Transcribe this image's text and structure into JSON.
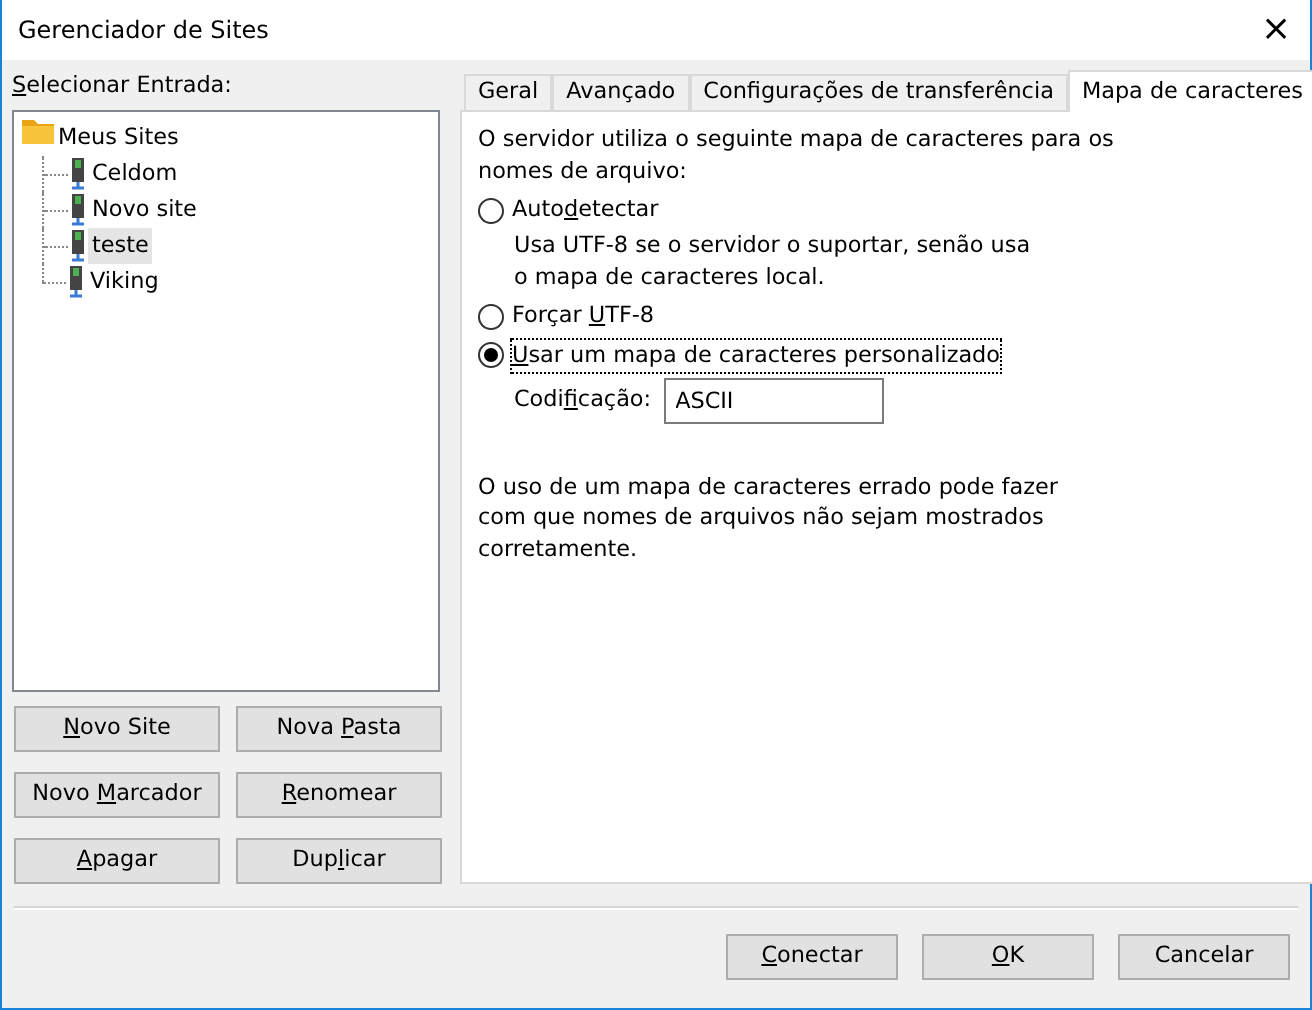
{
  "window": {
    "title": "Gerenciador de Sites",
    "close": "×"
  },
  "tree_label": {
    "key": "S",
    "post": "elecionar Entrada:"
  },
  "tree": {
    "label": "Meus Sites",
    "selected": false,
    "children": [
      {
        "label": "Celdom",
        "selected": false
      },
      {
        "label": "Novo site",
        "selected": false
      },
      {
        "label": "teste",
        "selected": true
      },
      {
        "label": "Viking",
        "selected": false
      }
    ]
  },
  "site_buttons": [
    {
      "key": "N",
      "post": "ovo Site"
    },
    {
      "pre": "Nova ",
      "key": "P",
      "post": "asta"
    },
    {
      "pre": "Novo ",
      "key": "M",
      "post": "arcador"
    },
    {
      "key": "R",
      "post": "enomear"
    },
    {
      "key": "A",
      "post": "pagar"
    },
    {
      "pre": "Dup",
      "key": "l",
      "post": "icar"
    }
  ],
  "tabs": [
    {
      "label": "Geral",
      "selected": false
    },
    {
      "label": "Avançado",
      "selected": false
    },
    {
      "label": "Configurações de transferência",
      "selected": false
    },
    {
      "label": "Mapa de caracteres",
      "selected": true
    }
  ],
  "intro": "O servidor utiliza o seguinte mapa de caracteres para os nomes de arquivo:",
  "options": [
    {
      "label": {
        "pre": "Auto",
        "key": "d",
        "post": "etectar"
      },
      "selected": false,
      "focused": false,
      "note": "Usa UTF-8 se o servidor o suportar, senão usa o mapa de caracteres local."
    },
    {
      "label": {
        "pre": "Forçar ",
        "key": "U",
        "post": "TF-8"
      },
      "selected": false,
      "focused": false
    },
    {
      "label": {
        "key": "U",
        "post": "sar um mapa de caracteres personalizado"
      },
      "selected": true,
      "focused": true
    }
  ],
  "encoding": {
    "label": {
      "pre": "Codi",
      "key": "f",
      "post": "icação:"
    },
    "value": "ASCII"
  },
  "warning": "O uso de um mapa de caracteres errado pode fazer com que nomes de arquivos não sejam mostrados corretamente.",
  "dialog_buttons": [
    {
      "key": "C",
      "post": "onectar"
    },
    {
      "key": "O",
      "post": "K"
    },
    {
      "pre": "Cancelar"
    }
  ]
}
